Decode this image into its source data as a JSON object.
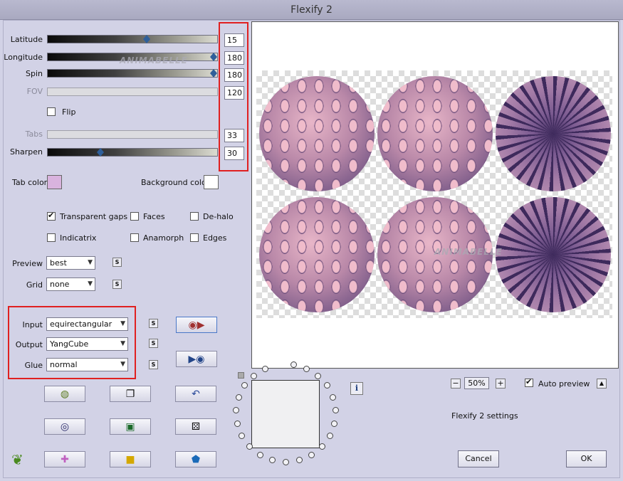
{
  "window": {
    "title": "Flexify 2"
  },
  "sliders": [
    {
      "label": "Latitude",
      "value": "15",
      "level": 0.58,
      "enabled": true
    },
    {
      "label": "Longitude",
      "value": "180",
      "level": 0.98,
      "enabled": true
    },
    {
      "label": "Spin",
      "value": "180",
      "level": 0.98,
      "enabled": true
    },
    {
      "label": "FOV",
      "value": "120",
      "level": 0.0,
      "enabled": false
    }
  ],
  "flip": {
    "label": "Flip",
    "checked": false
  },
  "tabs": {
    "label": "Tabs",
    "value": "33",
    "enabled": false
  },
  "sharpen": {
    "label": "Sharpen",
    "value": "30",
    "level": 0.3
  },
  "colors": {
    "tab_color_label": "Tab color",
    "tab_color": "#d9b3de",
    "background_color_label": "Background color",
    "background_color": "#ffffff"
  },
  "options": {
    "transparent_gaps": "Transparent gaps",
    "faces": "Faces",
    "de_halo": "De-halo",
    "indicatrix": "Indicatrix",
    "anamorph": "Anamorph",
    "edges": "Edges"
  },
  "preview_select": {
    "label": "Preview",
    "value": "best"
  },
  "grid_select": {
    "label": "Grid",
    "value": "none"
  },
  "input_select": {
    "label": "Input",
    "value": "equirectangular"
  },
  "output_select": {
    "label": "Output",
    "value": "YangCube"
  },
  "glue_select": {
    "label": "Glue",
    "value": "normal"
  },
  "s_button_label": "S",
  "watermark": "ANIMABELLE",
  "zoom": {
    "value": "50%",
    "minus": "−",
    "plus": "+"
  },
  "auto_preview": {
    "label": "Auto preview",
    "checked": true
  },
  "settings_label": "Flexify 2 settings",
  "buttons": {
    "cancel": "Cancel",
    "ok": "OK"
  },
  "info_icon": "i",
  "accent": {
    "highlight": "#e02020"
  }
}
